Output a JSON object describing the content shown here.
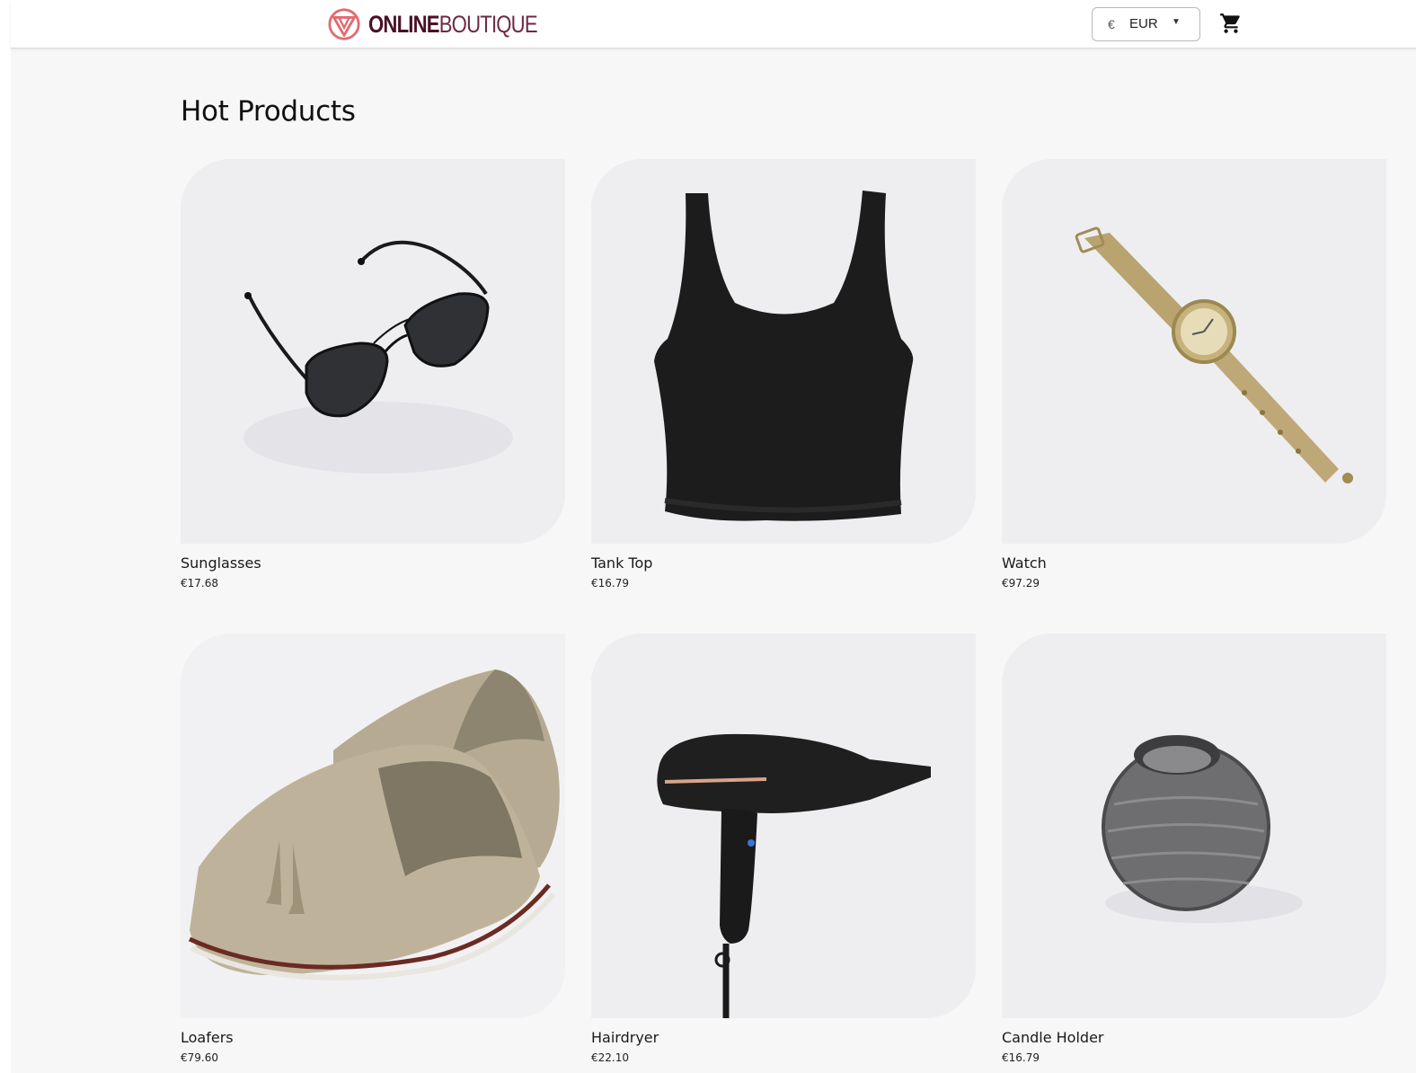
{
  "header": {
    "logo": {
      "part1": "ONLINE",
      "part2": "BOUTIQUE"
    },
    "currency": {
      "symbol": "€",
      "code": "EUR"
    },
    "cart_icon": "shopping-cart-icon"
  },
  "main": {
    "title": "Hot Products",
    "products": [
      {
        "name": "Sunglasses",
        "price": "€17.68",
        "image": "sunglasses"
      },
      {
        "name": "Tank Top",
        "price": "€16.79",
        "image": "tank-top"
      },
      {
        "name": "Watch",
        "price": "€97.29",
        "image": "watch"
      },
      {
        "name": "Loafers",
        "price": "€79.60",
        "image": "loafers"
      },
      {
        "name": "Hairdryer",
        "price": "€22.10",
        "image": "hairdryer"
      },
      {
        "name": "Candle Holder",
        "price": "€16.79",
        "image": "candle-holder"
      }
    ]
  },
  "colors": {
    "brand_dark": "#4a1026",
    "brand_light": "#6d2a46",
    "logo_mark": "#e36a6f",
    "background": "#f7f7f7"
  }
}
